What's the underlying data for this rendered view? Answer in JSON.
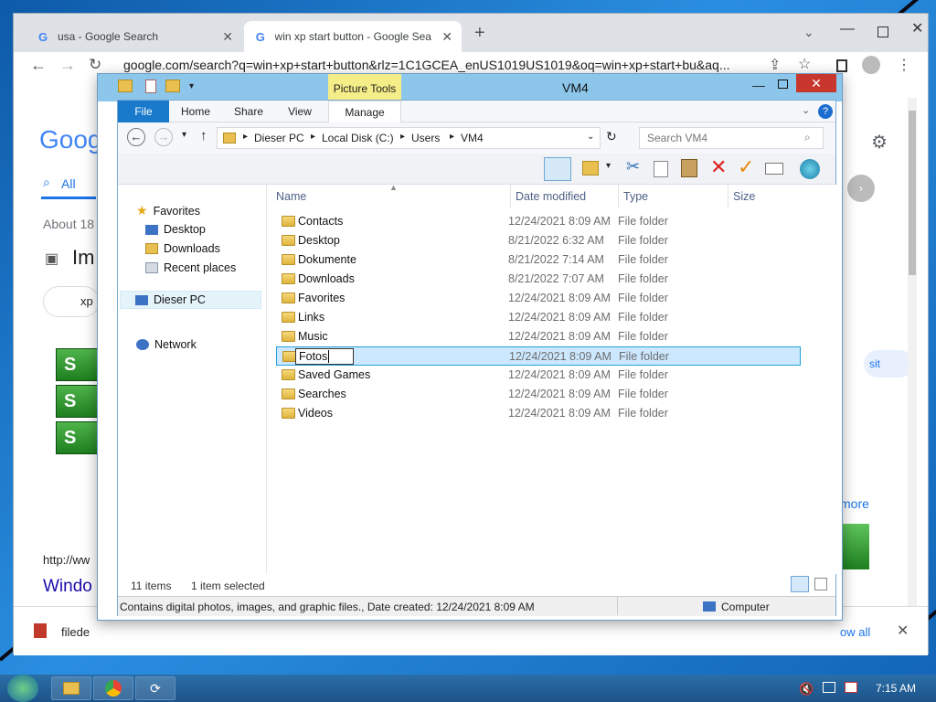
{
  "browser": {
    "tabs": [
      {
        "title": "usa - Google Search",
        "close": "✕"
      },
      {
        "title": "win xp start button - Google Sea",
        "close": "✕"
      }
    ],
    "new_tab": "+",
    "url": "google.com/search?q=win+xp+start+button&rlz=1C1GCEA_enUS1019US1019&oq=win+xp+start+bu&aq...",
    "page": {
      "logo": "Goog",
      "tab_all": "All",
      "about": "About 18",
      "images": "Im",
      "xp_chip": "xp",
      "start_text": "S",
      "http": "http://ww",
      "windo": "Windo",
      "visit": "sit",
      "more": "more",
      "download_name": "filede",
      "show_all": "ow all"
    }
  },
  "explorer": {
    "title": "VM4",
    "context_tab": "Picture Tools",
    "ribbon_tabs": {
      "file": "File",
      "home": "Home",
      "share": "Share",
      "view": "View",
      "manage": "Manage"
    },
    "breadcrumb": [
      "Dieser PC",
      "Local Disk (C:)",
      "Users",
      "VM4"
    ],
    "search_placeholder": "Search VM4",
    "nav": {
      "favorites": "Favorites",
      "desktop": "Desktop",
      "downloads": "Downloads",
      "recent": "Recent places",
      "pc": "Dieser PC",
      "network": "Network"
    },
    "columns": {
      "name": "Name",
      "date": "Date modified",
      "type": "Type",
      "size": "Size"
    },
    "rows": [
      {
        "name": "Contacts",
        "date": "12/24/2021 8:09 AM",
        "type": "File folder"
      },
      {
        "name": "Desktop",
        "date": "8/21/2022 6:32 AM",
        "type": "File folder"
      },
      {
        "name": "Dokumente",
        "date": "8/21/2022 7:14 AM",
        "type": "File folder"
      },
      {
        "name": "Downloads",
        "date": "8/21/2022 7:07 AM",
        "type": "File folder"
      },
      {
        "name": "Favorites",
        "date": "12/24/2021 8:09 AM",
        "type": "File folder"
      },
      {
        "name": "Links",
        "date": "12/24/2021 8:09 AM",
        "type": "File folder"
      },
      {
        "name": "Music",
        "date": "12/24/2021 8:09 AM",
        "type": "File folder"
      },
      {
        "name": "Fotos",
        "date": "12/24/2021 8:09 AM",
        "type": "File folder"
      },
      {
        "name": "Saved Games",
        "date": "12/24/2021 8:09 AM",
        "type": "File folder"
      },
      {
        "name": "Searches",
        "date": "12/24/2021 8:09 AM",
        "type": "File folder"
      },
      {
        "name": "Videos",
        "date": "12/24/2021 8:09 AM",
        "type": "File folder"
      }
    ],
    "status_items": "11 items",
    "status_selected": "1 item selected",
    "details_text": "Contains digital photos, images, and graphic files., Date created: 12/24/2021 8:09 AM",
    "details_location": "Computer"
  },
  "taskbar": {
    "clock": "7:15 AM"
  }
}
